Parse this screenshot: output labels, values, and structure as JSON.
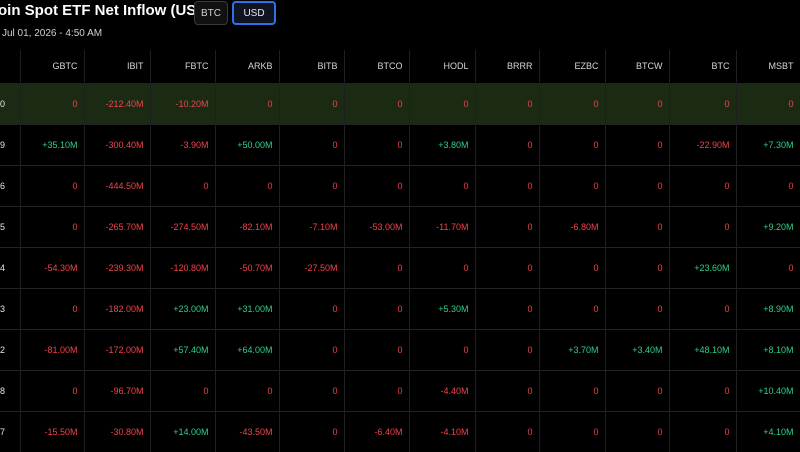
{
  "header": {
    "title": "oin Spot ETF Net Inflow (USD)",
    "subtitle": "Jul 01, 2026 - 4:50 AM",
    "toggle": {
      "btc_label": "BTC",
      "usd_label": "USD",
      "selected": "USD"
    }
  },
  "colors": {
    "negative": "#f0434c",
    "positive": "#2fd08a",
    "highlight_row": "#1b2a13",
    "toggle_active_border": "#2f6fe8"
  },
  "table": {
    "columns": [
      "",
      "GBTC",
      "IBIT",
      "FBTC",
      "ARKB",
      "BITB",
      "BTCO",
      "HODL",
      "BRRR",
      "EZBC",
      "BTCW",
      "BTC",
      "MSBT"
    ],
    "rows": [
      {
        "cells": [
          "0",
          "0",
          "-212.40M",
          "-10.20M",
          "0",
          "0",
          "0",
          "0",
          "0",
          "0",
          "0",
          "0",
          "0"
        ]
      },
      {
        "cells": [
          "9",
          "+35.10M",
          "-300.40M",
          "-3.90M",
          "+50.00M",
          "0",
          "0",
          "+3.80M",
          "0",
          "0",
          "0",
          "-22.90M",
          "+7.30M"
        ]
      },
      {
        "cells": [
          "6",
          "0",
          "-444.50M",
          "0",
          "0",
          "0",
          "0",
          "0",
          "0",
          "0",
          "0",
          "0",
          "0"
        ]
      },
      {
        "cells": [
          "5",
          "0",
          "-265.70M",
          "-274.50M",
          "-82.10M",
          "-7.10M",
          "-53.00M",
          "-11.70M",
          "0",
          "-6.80M",
          "0",
          "0",
          "+9.20M"
        ]
      },
      {
        "cells": [
          "4",
          "-54.30M",
          "-239.30M",
          "-120.80M",
          "-50.70M",
          "-27.50M",
          "0",
          "0",
          "0",
          "0",
          "0",
          "+23.60M",
          "0"
        ]
      },
      {
        "cells": [
          "3",
          "0",
          "-182.00M",
          "+23.00M",
          "+31.00M",
          "0",
          "0",
          "+5.30M",
          "0",
          "0",
          "0",
          "0",
          "+8.90M"
        ]
      },
      {
        "cells": [
          "2",
          "-81.00M",
          "-172.00M",
          "+57.40M",
          "+64.00M",
          "0",
          "0",
          "0",
          "0",
          "+3.70M",
          "+3.40M",
          "+48.10M",
          "+8.10M"
        ]
      },
      {
        "cells": [
          "8",
          "0",
          "-96.70M",
          "0",
          "0",
          "0",
          "0",
          "-4.40M",
          "0",
          "0",
          "0",
          "0",
          "+10.40M"
        ]
      },
      {
        "cells": [
          "7",
          "-15.50M",
          "-30.80M",
          "+14.00M",
          "-43.50M",
          "0",
          "-6.40M",
          "-4.10M",
          "0",
          "0",
          "0",
          "0",
          "+4.10M"
        ]
      }
    ]
  }
}
